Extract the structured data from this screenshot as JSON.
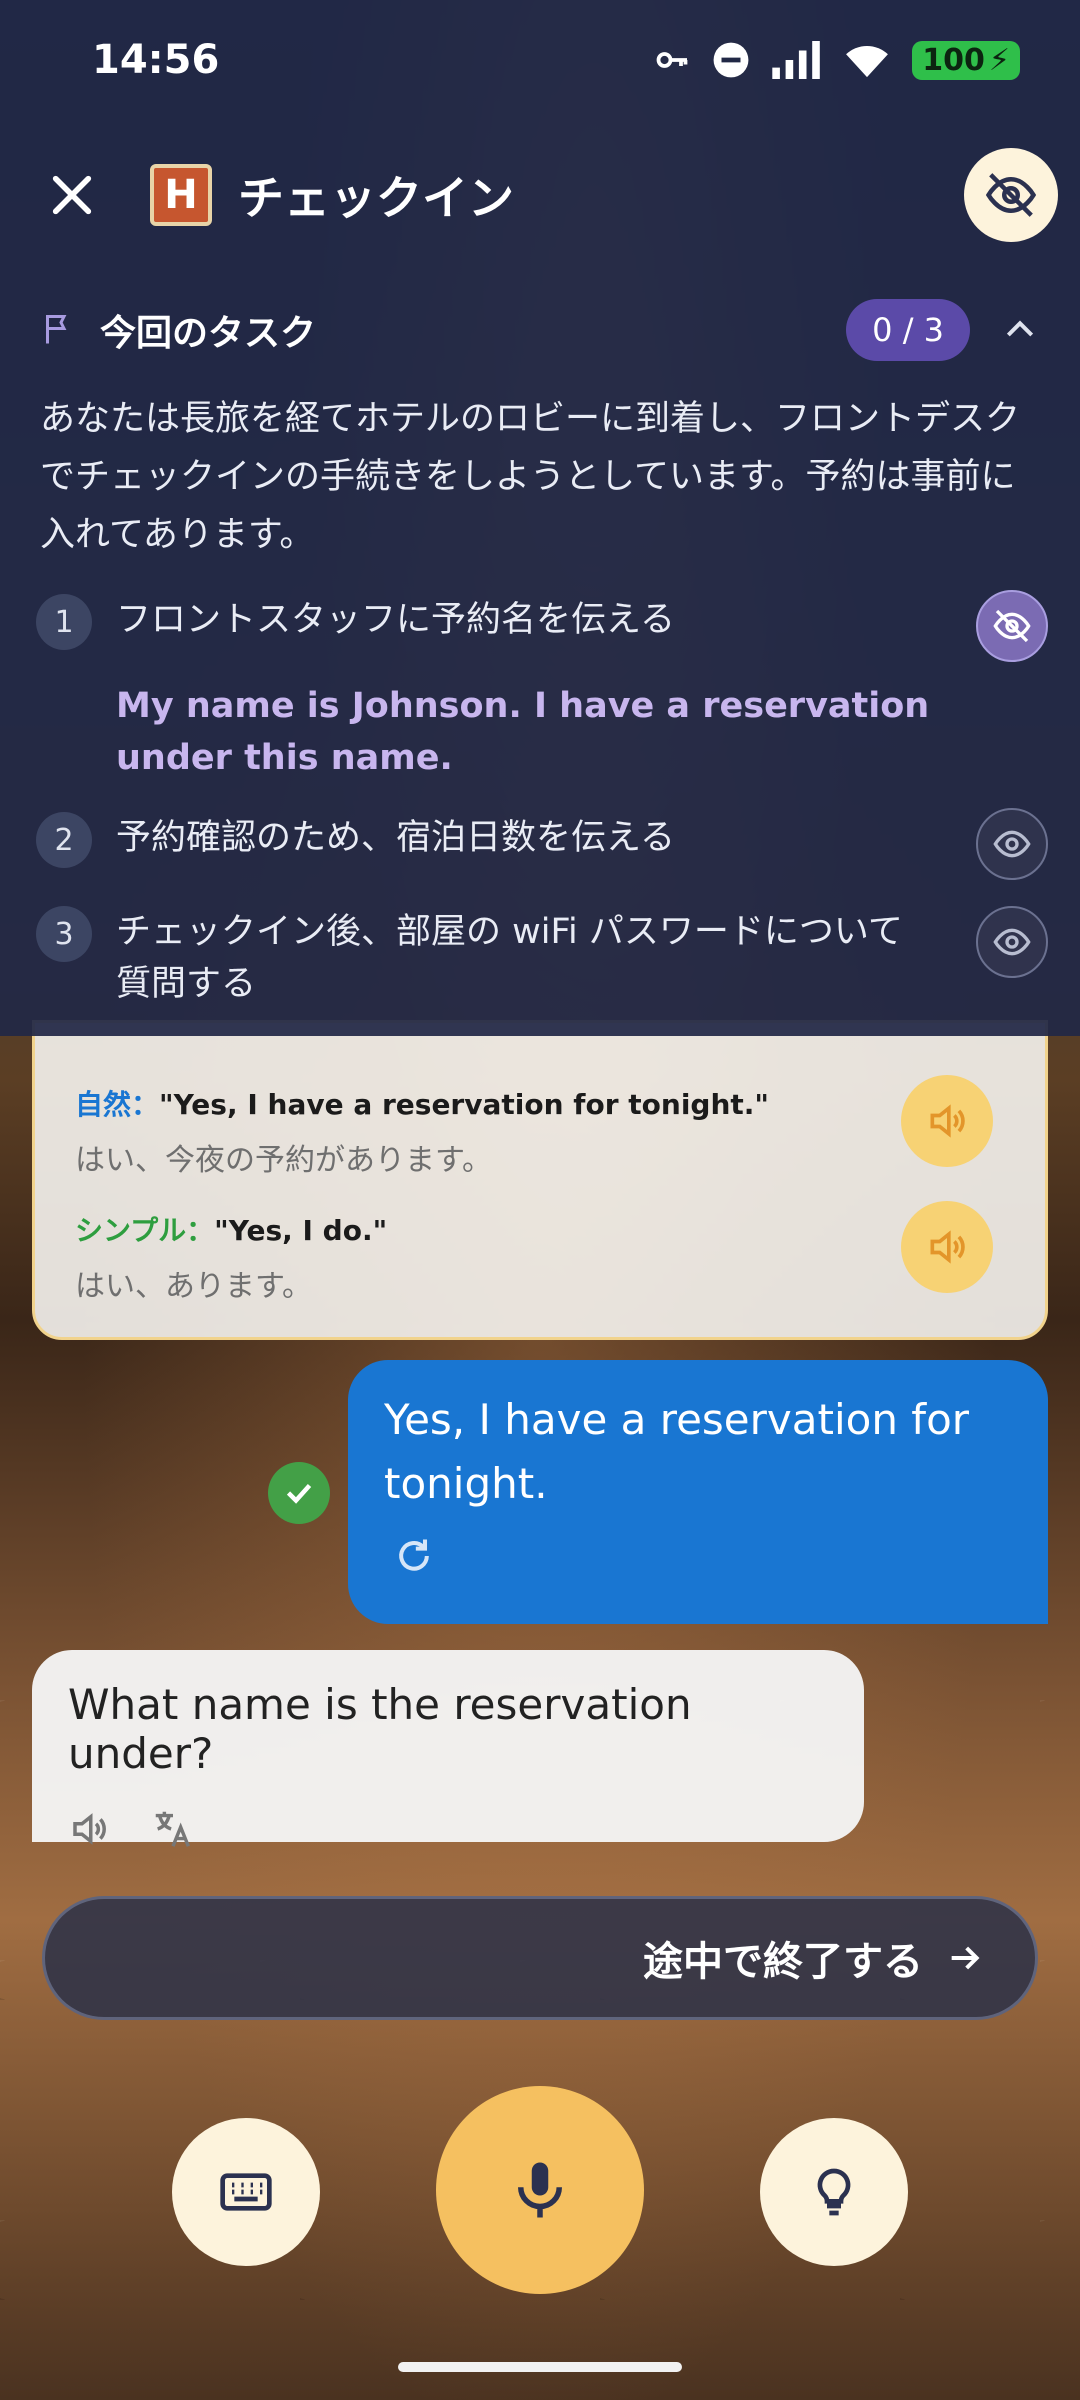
{
  "status_bar": {
    "time": "14:56",
    "battery": "100"
  },
  "header": {
    "title": "チェックイン",
    "emoji_letter": "H"
  },
  "task_panel": {
    "heading": "今回のタスク",
    "progress": "0 / 3",
    "description": "あなたは長旅を経てホテルのロビーに到着し、フロントデスクでチェックインの手続きをしようとしています。予約は事前に入れてあります。",
    "items": [
      {
        "num": "1",
        "text": "フロントスタッフに予約名を伝える",
        "hint": "My name is Johnson. I have a reservation under this name."
      },
      {
        "num": "2",
        "text": "予約確認のため、宿泊日数を伝える"
      },
      {
        "num": "3",
        "text": "チェックイン後、部屋の wiFi パスワードについて質問する"
      }
    ]
  },
  "suggestions": [
    {
      "label": "自然：",
      "label_color": "#1976d2",
      "english": "\"Yes, I have a reservation for tonight.\"",
      "japanese": "はい、今夜の予約があります。"
    },
    {
      "label": "シンプル：",
      "label_color": "#2e9e3f",
      "english": "\"Yes, I do.\"",
      "japanese": "はい、あります。"
    }
  ],
  "user_message": {
    "text": "Yes, I have a reservation for tonight."
  },
  "bot_message": {
    "text": "What name is the reservation under?"
  },
  "quit_button": {
    "label": "途中で終了する"
  },
  "colors": {
    "accent": "#f5c060",
    "user_bubble": "#1976d2",
    "panel": "#212846"
  }
}
